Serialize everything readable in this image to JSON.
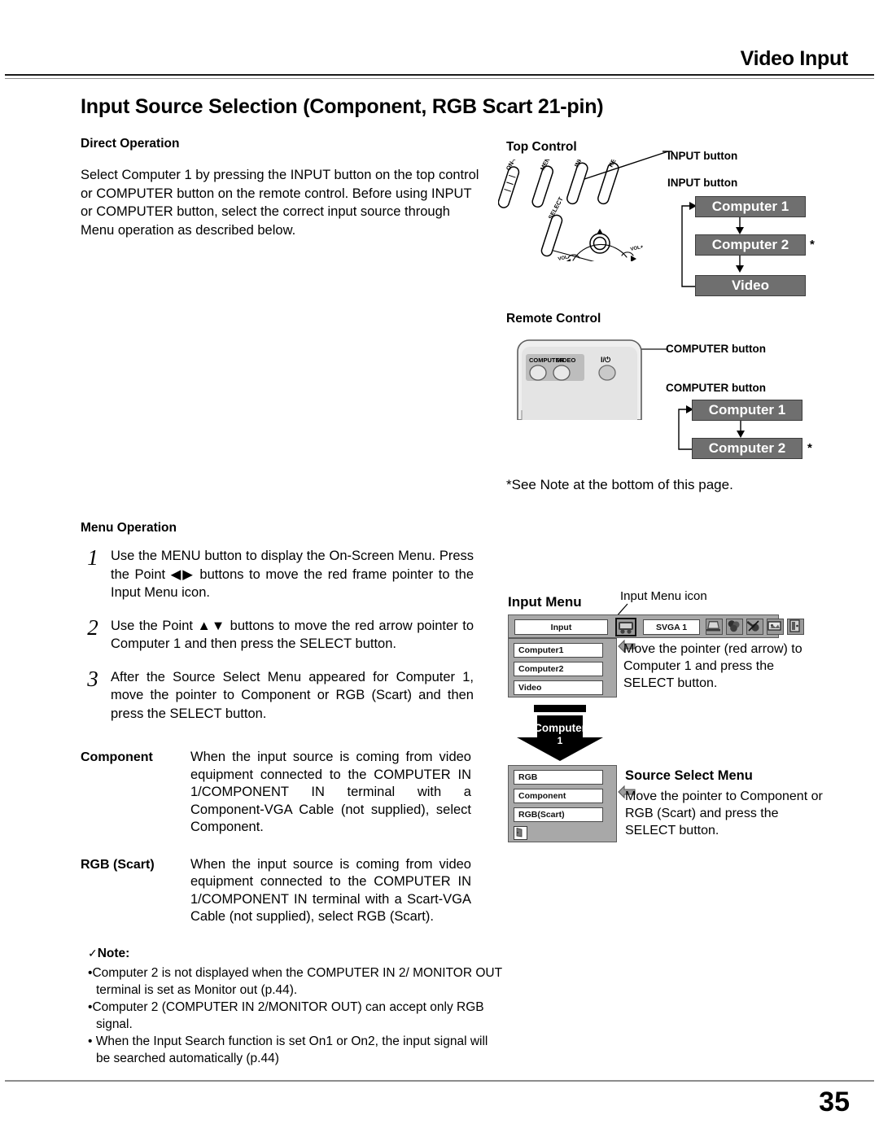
{
  "header": {
    "running_head": "Video Input",
    "title": "Input Source Selection (Component, RGB Scart 21-pin)"
  },
  "direct_operation": {
    "heading": "Direct Operation",
    "body": "Select Computer 1 by pressing the INPUT button on the top control or COMPUTER button on the remote control. Before using INPUT or COMPUTER button, select the correct input source through Menu operation as described below."
  },
  "menu_operation": {
    "heading": "Menu Operation",
    "steps": [
      {
        "num": "1",
        "text": "Use the MENU button to display the On-Screen Menu. Press the Point ◀▶ buttons to move the red frame pointer to the Input Menu icon."
      },
      {
        "num": "2",
        "text": "Use the Point ▲▼ buttons to move the red arrow pointer to Computer 1 and then press the SELECT button."
      },
      {
        "num": "3",
        "text": "After the Source Select Menu appeared for Computer 1, move the pointer to Component or RGB (Scart) and then press the SELECT button."
      }
    ]
  },
  "definitions": [
    {
      "term": "Component",
      "desc": "When the input source is coming from video equipment connected to the COMPUTER IN 1/COMPONENT IN terminal with a Component-VGA Cable (not supplied), select Component."
    },
    {
      "term": "RGB (Scart)",
      "desc": "When the input source is coming from video equipment connected to the COMPUTER IN 1/COMPONENT IN terminal with a Scart-VGA Cable (not supplied), select RGB (Scart)."
    }
  ],
  "note": {
    "check_mark": "✓",
    "heading": "Note:",
    "items": [
      "Computer 2 is not displayed when the COMPUTER IN 2/ MONITOR OUT terminal is set as Monitor out (p.44).",
      "Computer 2 (COMPUTER IN 2/MONITOR OUT) can accept only RGB signal.",
      "When the Input Search function is set On1 or On2, the input signal will be searched automatically (p.44)"
    ],
    "bullet": "•"
  },
  "top_control": {
    "heading": "Top Control",
    "callout_leader": "INPUT button",
    "flow_title": "INPUT button",
    "flow_items": [
      "Computer 1",
      "Computer 2",
      "Video"
    ],
    "asterisk": "*",
    "panel_buttons": [
      "ON-OFF",
      "MENU",
      "INPUT",
      "KEYSTONE",
      "SELECT"
    ],
    "panel_hints": [
      "VOL-",
      "VOL+"
    ]
  },
  "remote_control": {
    "heading": "Remote Control",
    "callout_leader": "COMPUTER button",
    "flow_title": "COMPUTER button",
    "flow_items": [
      "Computer 1",
      "Computer 2"
    ],
    "asterisk": "*",
    "remote_buttons": [
      "COMPUTER",
      "VIDEO"
    ],
    "power_symbol": "I/⏻",
    "footnote": "*See Note at the bottom of this page."
  },
  "input_menu": {
    "heading": "Input Menu",
    "icon_callout": "Input Menu icon",
    "menubar_title": "Input",
    "menubar_value": "SVGA 1",
    "menu_items": [
      "Computer1",
      "Computer2",
      "Video"
    ],
    "arrow": "⇐",
    "instruction": "Move the pointer (red arrow) to Computer 1 and press the SELECT button.",
    "toolbar_icons": [
      "input-menu-icon",
      "computer-icon",
      "color-adjust-icon",
      "image-adjust-icon",
      "screen-icon",
      "setting-icon"
    ]
  },
  "source_select": {
    "pointer_label_line1": "Computer",
    "pointer_label_line2": "1",
    "heading": "Source Select Menu",
    "menu_items": [
      "RGB",
      "Component",
      "RGB(Scart)"
    ],
    "arrow": "⇐",
    "instruction": "Move the pointer to Component or RGB (Scart) and press the SELECT button."
  },
  "footer": {
    "page_number": "35"
  },
  "colors": {
    "flow_box_fill": "#6f6f6f",
    "flow_box_text": "#ffffff",
    "osd_panel": "#a8a8a8",
    "osd_field": "#ffffff",
    "pointer_black": "#000000"
  }
}
